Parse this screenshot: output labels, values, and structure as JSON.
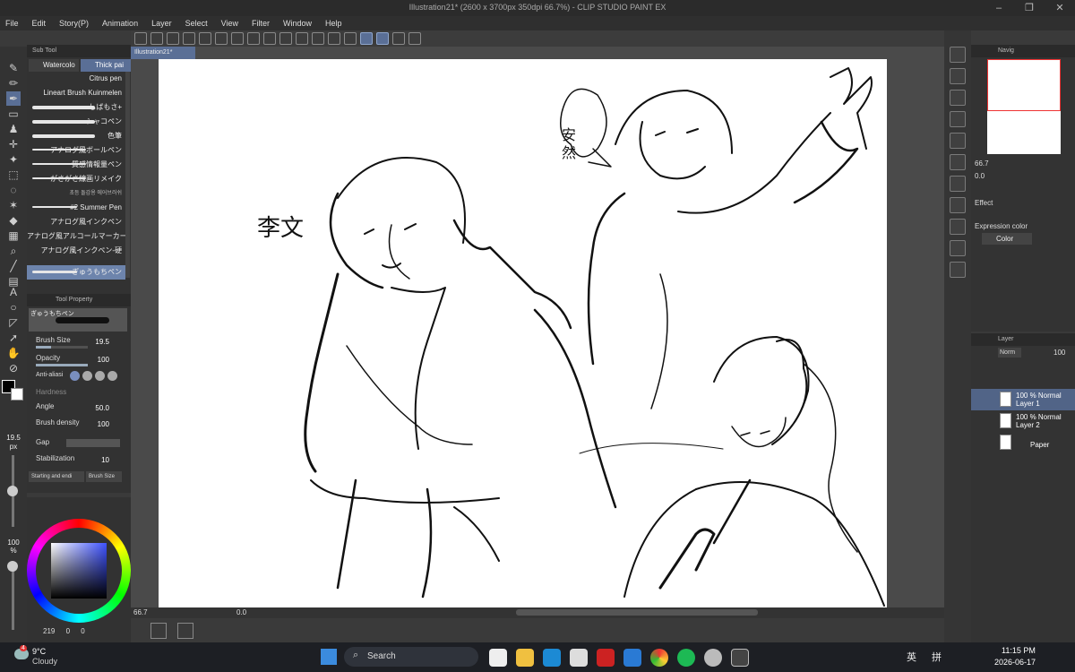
{
  "window": {
    "title": "Illustration21* (2600 x 3700px 350dpi 66.7%) - CLIP STUDIO PAINT EX",
    "min": "–",
    "max": "❐",
    "close": "✕"
  },
  "menu": [
    "File",
    "Edit",
    "Story(P)",
    "Animation",
    "Layer",
    "Select",
    "View",
    "Filter",
    "Window",
    "Help"
  ],
  "subtool": {
    "header": "Sub Tool",
    "tabs": [
      "Watercolo",
      "Thick pai"
    ],
    "brushes": [
      "Citrus pen",
      "Lineart Brush Kuinmelen",
      "しばもさ+",
      "シャコペン",
      "色筆",
      "アナログ風ボールペン",
      "質感情報量ペン",
      "がさがさ線画リメイク",
      "초등 돌감용 에어브러쉬",
      "#2 Summer Pen",
      "アナログ風インクペン",
      "アナログ風アルコールマーカー II",
      "アナログ風インクペン-硬",
      "ぎゅうもちペン"
    ]
  },
  "toolprop": {
    "header": "Tool Property",
    "brush_name": "ぎゅうもちペン",
    "rows": [
      {
        "label": "Brush Size",
        "value": "19.5"
      },
      {
        "label": "Opacity",
        "value": "100"
      },
      {
        "label": "Anti-aliasi",
        "value": ""
      },
      {
        "label": "Hardness",
        "value": ""
      },
      {
        "label": "Angle",
        "value": "50.0"
      },
      {
        "label": "Brush density",
        "value": "100"
      },
      {
        "label": "Gap",
        "value": ""
      },
      {
        "label": "Stabilization",
        "value": "10"
      }
    ],
    "starting": "Starting and endi",
    "brush_size_btn": "Brush Size"
  },
  "leftstrip": {
    "size": "19.5",
    "size_unit": "px",
    "opacity": "100",
    "opacity_unit": "%"
  },
  "color_status": {
    "a": "219",
    "b": "0",
    "c": "0"
  },
  "canvas": {
    "tab": "Illustration21*",
    "zoom": "66.7",
    "rotation": "0.0",
    "handwriting": "李文",
    "bubble": "安然"
  },
  "navigator": {
    "header": "Navig",
    "zoom": "66.7",
    "rotation": "0.0"
  },
  "effect": {
    "label": "Effect",
    "expression_label": "Expression color",
    "expression_value": "Color"
  },
  "layers": {
    "header": "Layer",
    "blend": "Norm",
    "opacity": "100",
    "items": [
      {
        "line1": "100 % Normal",
        "line2": "Layer 1"
      },
      {
        "line1": "100 % Normal",
        "line2": "Layer 2"
      },
      {
        "line1": "",
        "line2": "Paper"
      }
    ]
  },
  "taskbar": {
    "temp": "9°C",
    "weather": "Cloudy",
    "search": "Search",
    "lang1": "英",
    "lang2": "拼",
    "time": "11:15 PM",
    "date": "2026-06-17",
    "notif": "4"
  }
}
